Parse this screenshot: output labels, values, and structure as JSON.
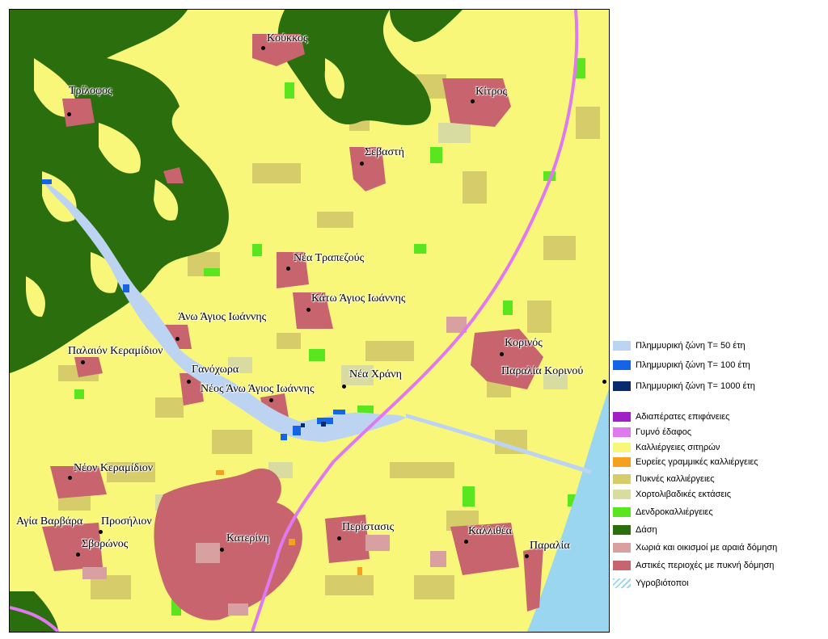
{
  "places": [
    {
      "name": "Κούκκος"
    },
    {
      "name": "Τρίλοφος"
    },
    {
      "name": "Κίτρος"
    },
    {
      "name": "Σεβαστή"
    },
    {
      "name": "Νέα Τραπεζούς"
    },
    {
      "name": "Κάτω Άγιος Ιωάννης"
    },
    {
      "name": "Άνω Άγιος Ιωάννης"
    },
    {
      "name": "Κορινός"
    },
    {
      "name": "Παραλία Κορινού"
    },
    {
      "name": "Παλαιόν Κεραμίδιον"
    },
    {
      "name": "Γανόχωρα"
    },
    {
      "name": "Νέα Χράνη"
    },
    {
      "name": "Νέος Άνω Άγιος Ιωάννης"
    },
    {
      "name": "Νέον Κεραμίδιον"
    },
    {
      "name": "Αγία Βαρβάρα"
    },
    {
      "name": "Προσήλιον"
    },
    {
      "name": "Σβορώνος"
    },
    {
      "name": "Κατερίνη"
    },
    {
      "name": "Περίστασις"
    },
    {
      "name": "Καλλιθέα"
    },
    {
      "name": "Παραλία"
    }
  ],
  "legend": {
    "items": [
      {
        "label": "Πλημμυρική ζώνη Τ= 50 έτη",
        "color": "#bcd4f2"
      },
      {
        "label": "Πλημμυρική ζώνη Τ= 100 έτη",
        "color": "#1464e6"
      },
      {
        "label": "Πλημμυρική ζώνη Τ= 1000 έτη",
        "color": "#0a2a6e"
      },
      {
        "label": "Αδιαπέρατες επιφάνειες",
        "color": "#a020c8"
      },
      {
        "label": "Γυμνό έδαφος",
        "color": "#e078f0"
      },
      {
        "label": "Καλλιέργειες σιτηρών",
        "color": "#f9f77a"
      },
      {
        "label": "Ευρείες γραμμικές καλλιέργειες",
        "color": "#f5a01e"
      },
      {
        "label": "Πυκνές καλλιέργειες",
        "color": "#d6cc6a"
      },
      {
        "label": "Χορτολιβαδικές εκτάσεις",
        "color": "#d8dca0"
      },
      {
        "label": "Δενδροκαλλιέργειες",
        "color": "#5ae61e"
      },
      {
        "label": "Δάση",
        "color": "#2a6e0e"
      },
      {
        "label": "Χωριά και οικισμοί με αραιά δόμηση",
        "color": "#d8a0a0"
      },
      {
        "label": "Αστικές περιοχές με πυκνή δόμηση",
        "color": "#c8646e"
      },
      {
        "label": "Υγροβιότοποι",
        "color": "#9ad6f0"
      }
    ]
  },
  "colors": {
    "background": "#f9f77a",
    "sea": "#9ad6f0",
    "forest": "#2a6e0e",
    "urban": "#c8646e",
    "road": "#e078f0"
  }
}
